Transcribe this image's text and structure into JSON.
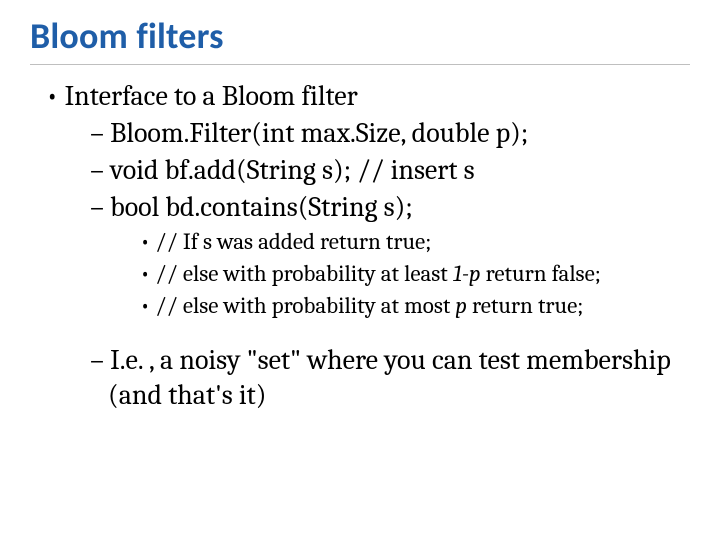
{
  "title": "Bloom filters",
  "l1_interface": "Interface to a Bloom filter",
  "l2_ctor": "Bloom.Filter(int max.Size, double p);",
  "l2_add": "void bf.add(String s); // insert s",
  "l2_contains": "bool bd.contains(String s);",
  "l3_a": "// If s was added return true;",
  "l3_b_pre": "// else with probability at least ",
  "l3_b_em": "1-p",
  "l3_b_post": " return false;",
  "l3_c_pre": "// else with probability at most ",
  "l3_c_em": "p",
  "l3_c_post": " return true;",
  "l2_ie": "I.e. , a noisy \"set\" where you can test membership (and that's it)"
}
